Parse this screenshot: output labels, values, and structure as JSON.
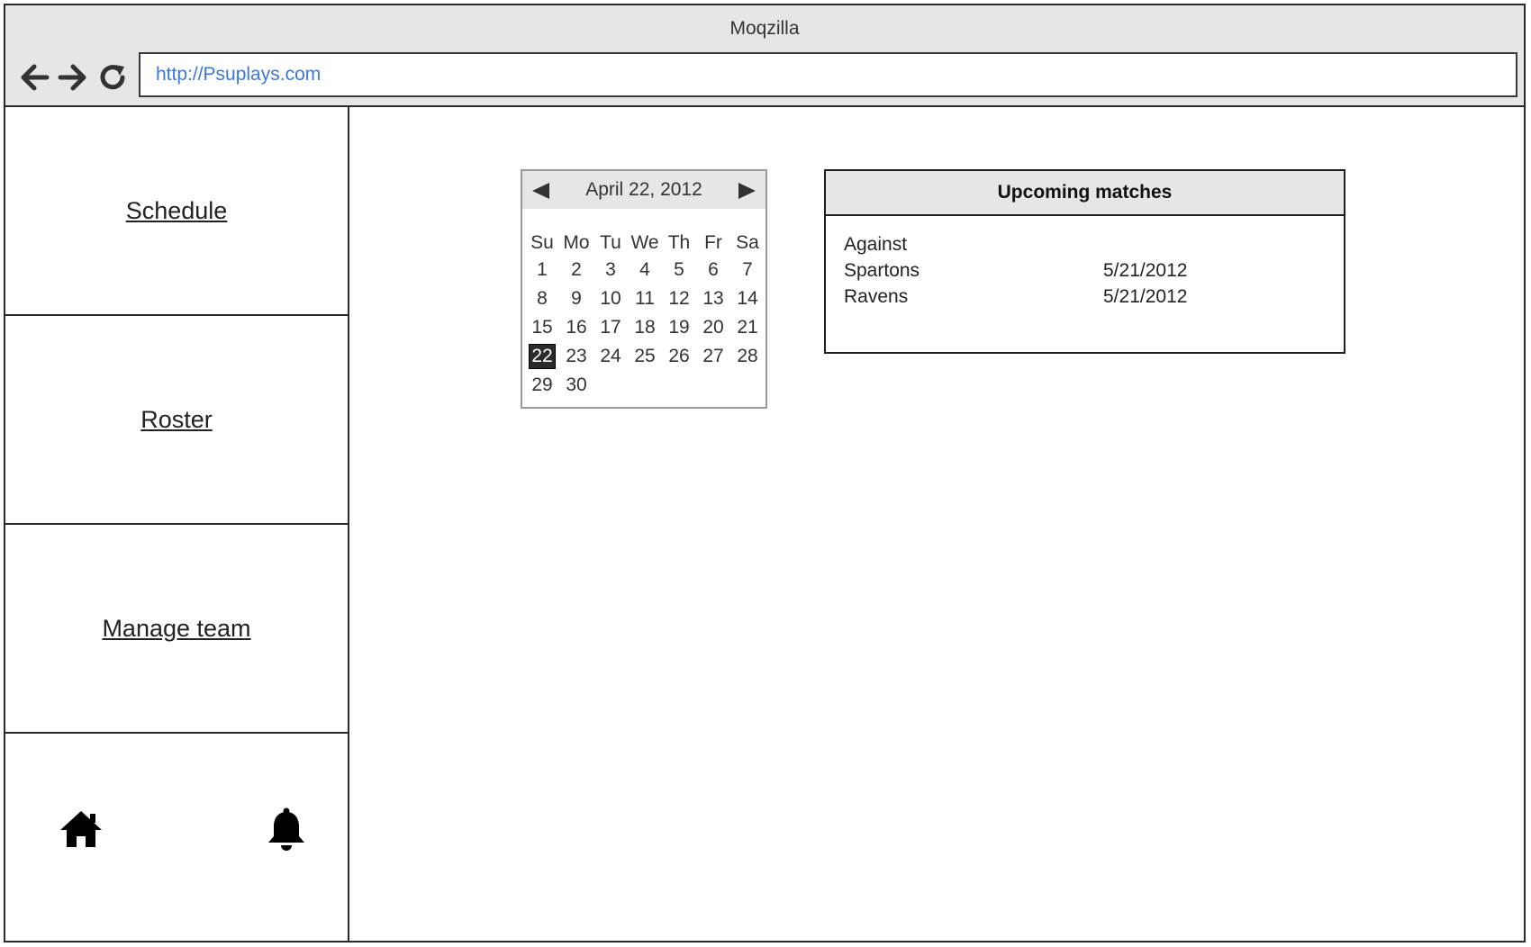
{
  "browser": {
    "title": "Moqzilla",
    "url": "http://Psuplays.com",
    "icons": [
      "arrow-left-icon",
      "arrow-right-icon",
      "refresh-icon"
    ]
  },
  "sidebar": {
    "items": [
      {
        "label": "Schedule"
      },
      {
        "label": "Roster"
      },
      {
        "label": "Manage team"
      }
    ],
    "icons": [
      "home-icon",
      "bell-icon"
    ]
  },
  "calendar": {
    "title": "April 22, 2012",
    "weekdays": [
      "Su",
      "Mo",
      "Tu",
      "We",
      "Th",
      "Fr",
      "Sa"
    ],
    "weeks": [
      [
        "1",
        "2",
        "3",
        "4",
        "5",
        "6",
        "7"
      ],
      [
        "8",
        "9",
        "10",
        "11",
        "12",
        "13",
        "14"
      ],
      [
        "15",
        "16",
        "17",
        "18",
        "19",
        "20",
        "21"
      ],
      [
        "22",
        "23",
        "24",
        "25",
        "26",
        "27",
        "28"
      ],
      [
        "29",
        "30",
        "",
        "",
        "",
        "",
        ""
      ]
    ],
    "selected_day": "22",
    "icons": [
      "triangle-left-icon",
      "triangle-right-icon"
    ]
  },
  "matches": {
    "title": "Upcoming matches",
    "column_header": "Against",
    "rows": [
      {
        "team": "Spartons",
        "date": "5/21/2012"
      },
      {
        "team": "Ravens",
        "date": "5/21/2012"
      }
    ]
  }
}
